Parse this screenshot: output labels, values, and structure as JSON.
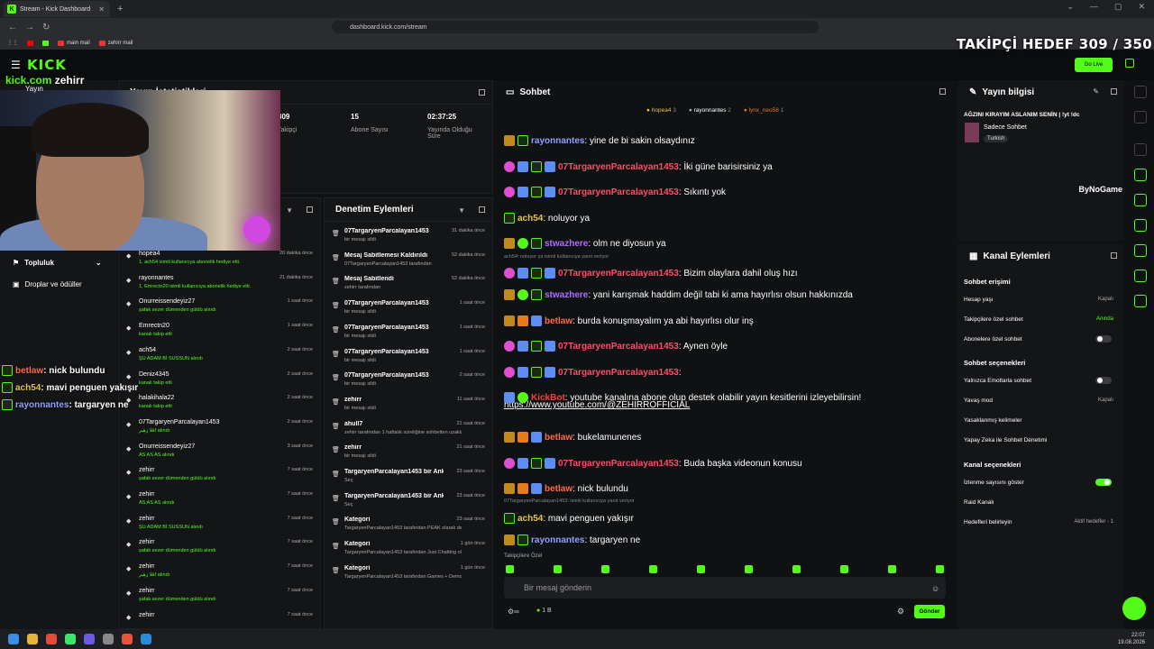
{
  "browser": {
    "tab_title": "Stream - Kick Dashboard",
    "url": "dashboard.kick.com/stream",
    "bookmarks": [
      "main mail",
      "zehirr mail"
    ]
  },
  "overlay": {
    "follower_goal": "TAKİPÇİ HEDEF 309 / 350",
    "brand": "kick.com",
    "streamer": "zehirr",
    "chat": [
      {
        "user": "betlaw",
        "text": ": nick bulundu",
        "color": "#ff6a4d"
      },
      {
        "user": "ach54",
        "text": ": mavi penguen yakışır",
        "color": "#e6c24a"
      },
      {
        "user": "rayonnantes",
        "text": ": targaryen ne",
        "color": "#8da0ff"
      }
    ]
  },
  "topnav": {
    "go_live": "Go Live"
  },
  "sidebar": {
    "partial_label": "Yayın",
    "items": [
      {
        "label": "Topluluk"
      },
      {
        "label": "Droplar ve ödüller"
      }
    ]
  },
  "stats": {
    "title": "Yayın İstatistikleri",
    "items": [
      {
        "value": "309",
        "label": "Takipçi"
      },
      {
        "value": "15",
        "label": "Abone Sayısı"
      },
      {
        "value": "02:37:25",
        "label": "Yayında Olduğu Süre"
      }
    ]
  },
  "activity": {
    "events": [
      {
        "user": "hopea4",
        "desc": "1, ach54 isimli kullanıcıya abonelik hediye etti.",
        "time": "20 dakika önce"
      },
      {
        "user": "rayonnantes",
        "desc": "1, Emrectn20 isimli kullanıcıya abonelik hediye etti.",
        "time": "21 dakika önce"
      },
      {
        "user": "Onurreissendeyiz27",
        "desc": "şafak sezer dümenden güldü alındı",
        "time": "1 saat önce"
      },
      {
        "user": "Emrectn20",
        "desc": "kanalı takip etti",
        "time": "1 saat önce"
      },
      {
        "user": "ach54",
        "desc": "ŞU ADAM Bİ SUSSUN alındı",
        "time": "2 saat önce"
      },
      {
        "user": "Deniz4345",
        "desc": "kanalı takip etti",
        "time": "2 saat önce"
      },
      {
        "user": "halakihala22",
        "desc": "kanalı takip etti",
        "time": "2 saat önce"
      },
      {
        "user": "07TargaryenParcalayan1453",
        "desc": "اقلا زهير alındı",
        "time": "2 saat önce"
      },
      {
        "user": "Onurreissendeyiz27",
        "desc": "AS AS AS alındı",
        "time": "3 saat önce"
      },
      {
        "user": "zehirr",
        "desc": "şafak sezer dümenden güldü alındı",
        "time": "7 saat önce"
      },
      {
        "user": "zehirr",
        "desc": "AS AS AS alındı",
        "time": "7 saat önce"
      },
      {
        "user": "zehirr",
        "desc": "ŞU ADAM Bİ SUSSUN alındı",
        "time": "7 saat önce"
      },
      {
        "user": "zehirr",
        "desc": "şafak sezer dümenden güldü alındı",
        "time": "7 saat önce"
      },
      {
        "user": "zehirr",
        "desc": "اقلا زهير alındı",
        "time": "7 saat önce"
      },
      {
        "user": "zehirr",
        "desc": "şafak sezer dümenden güldü alındı",
        "time": "7 saat önce"
      },
      {
        "user": "zehirr",
        "desc": "",
        "time": "7 saat önce"
      }
    ]
  },
  "moderation": {
    "title": "Denetim Eylemleri",
    "events": [
      {
        "user": "07TargaryenParcalayan1453",
        "desc": "bir mesajı sildi",
        "time": "31 dakika önce"
      },
      {
        "user": "Mesaj Sabitlemesi Kaldırıldı",
        "desc": "07TargaryenParcalayan1453 tarafından",
        "time": "52 dakika önce"
      },
      {
        "user": "Mesaj Sabitlendi",
        "desc": "zehirr tarafından",
        "time": "52 dakika önce"
      },
      {
        "user": "07TargaryenParcalayan1453",
        "desc": "bir mesajı sildi",
        "time": "1 saat önce"
      },
      {
        "user": "07TargaryenParcalayan1453",
        "desc": "bir mesajı sildi",
        "time": "1 saat önce"
      },
      {
        "user": "07TargaryenParcalayan1453",
        "desc": "bir mesajı sildi",
        "time": "1 saat önce"
      },
      {
        "user": "07TargaryenParcalayan1453",
        "desc": "bir mesajı sildi",
        "time": "2 saat önce"
      },
      {
        "user": "zehirr",
        "desc": "bir mesajı sildi",
        "time": "11 saat önce"
      },
      {
        "user": "ahull7",
        "desc": "zehirr tarafından 1 haftalık süreliğine sohbetten uzaklaştırıldı",
        "time": "21 saat önce"
      },
      {
        "user": "zehirr",
        "desc": "bir mesajı sildi",
        "time": "21 saat önce"
      },
      {
        "user": "TargaryenParcalayan1453 bir Anketi kaldırdı",
        "desc": "Seç",
        "time": "23 saat önce"
      },
      {
        "user": "TargaryenParcalayan1453 bir Anket başlattı",
        "desc": "Seç",
        "time": "23 saat önce"
      },
      {
        "user": "Kategori",
        "desc": "TargaryenParcalayan1453 tarafından PEAK olarak değiştirildi",
        "time": "23 saat önce"
      },
      {
        "user": "Kategori",
        "desc": "TargaryenParcalayan1453 tarafından Just Chatting olarak değiştirildi",
        "time": "1 gün önce"
      },
      {
        "user": "Kategori",
        "desc": "TargaryenParcalayan1453 tarafından Games + Demos olarak değiştirildi",
        "time": "1 gün önce"
      }
    ]
  },
  "chat": {
    "title": "Sohbet",
    "top_chatters": [
      {
        "name": "hopea4",
        "count": "3"
      },
      {
        "name": "rayonnantes",
        "count": "2"
      },
      {
        "name": "lynx_neo58",
        "count": "1"
      }
    ],
    "messages": [
      {
        "user": "rayonnantes",
        "text": ": yine de bi sakin olsaydınız",
        "color": "#8da0ff"
      },
      {
        "user": "07TargaryenParcalayan1453",
        "text": ": İki güne barisirsiniz ya",
        "color": "#ff4d6a"
      },
      {
        "user": "07TargaryenParcalayan1453",
        "text": ": Sıkıntı yok",
        "color": "#ff4d6a"
      },
      {
        "user": "ach54",
        "text": ": noluyor ya",
        "color": "#e6c24a"
      },
      {
        "user": "stwazhere",
        "text": ": olm ne diyosun ya",
        "color": "#b06cff"
      },
      {
        "user": "07TargaryenParcalayan1453",
        "text": ": Bizim olaylara dahil oluş hızı",
        "color": "#ff4d6a"
      },
      {
        "user": "stwazhere",
        "text": ": yani karışmak haddim değil tabi ki ama hayırlısı olsun hakkınızda",
        "color": "#b06cff"
      },
      {
        "user": "betlaw",
        "text": ": burda konuşmayalım ya abi hayırlısı olur inş",
        "color": "#ff6a4d"
      },
      {
        "user": "07TargaryenParcalayan1453",
        "text": ": Aynen öyle",
        "color": "#ff4d6a"
      },
      {
        "user": "07TargaryenParcalayan1453",
        "text": ":",
        "color": "#ff4d6a"
      },
      {
        "user": "KickBot",
        "text": ": youtube kanalına abone olup destek olabilir yayın kesitlerini izleyebilirsin!",
        "color": "#ff3b3b"
      },
      {
        "user": "betlaw",
        "text": ": bukelamunenes",
        "color": "#ff6a4d"
      },
      {
        "user": "07TargaryenParcalayan1453",
        "text": ": Buda başka videonun konusu",
        "color": "#ff4d6a"
      },
      {
        "user": "betlaw",
        "text": ": nick bulundu",
        "color": "#ff6a4d"
      },
      {
        "user": "ach54",
        "text": ": mavi penguen yakışır",
        "color": "#e6c24a"
      },
      {
        "user": "rayonnantes",
        "text": ": targaryen ne",
        "color": "#8da0ff"
      }
    ],
    "link": "https://www.youtube.com/@ZEHIRROFFICIAL",
    "reply1": "ach54: noluyor ya isimli kullanıcıya yanıt veriyor",
    "reply2": "07TargaryenParcalayan1453: isimli kullanıcıya yanıt veriyor",
    "followers_only": "Takipçilere Özel",
    "placeholder": "Bir mesaj gönderin",
    "viewer_count": "1 B",
    "send": "Gönder"
  },
  "stream_info": {
    "title": "Yayın bilgisi",
    "stream_title": "AĞZINI KIRAYIM ASLANIM SENİN | !yt !dc",
    "category": "Sadece Sohbet",
    "language": "Turkish",
    "sponsor": "ByNoGame"
  },
  "channel_actions": {
    "title": "Kanal Eylemleri",
    "section1": "Sohbet erişimi",
    "account_age": {
      "label": "Hesap yaşı",
      "value": "Kapalı"
    },
    "followers_chat": {
      "label": "Takipçilere özel sohbet",
      "value": "Anında"
    },
    "subs_chat": {
      "label": "Abonelere özel sohbet"
    },
    "section2": "Sohbet seçenekleri",
    "emotes_only": {
      "label": "Yalnızca Emotlarla sohbet"
    },
    "slow_mode": {
      "label": "Yavaş mod",
      "value": "Kapalı"
    },
    "banned_words": {
      "label": "Yasaklanmış kelimeler"
    },
    "ai_moderation": {
      "label": "Yapay Zeka ile Sohbet Denetimi"
    },
    "section3": "Kanal seçenekleri",
    "viewer_count": {
      "label": "İzlenme sayısını göster"
    },
    "raid": {
      "label": "Raid Kanalı"
    },
    "goals": {
      "label": "Hedefleri belirleyin",
      "value": "Aktif hedefler - 1"
    }
  },
  "clock": {
    "time": "22:07",
    "date": "19.08.2026"
  }
}
